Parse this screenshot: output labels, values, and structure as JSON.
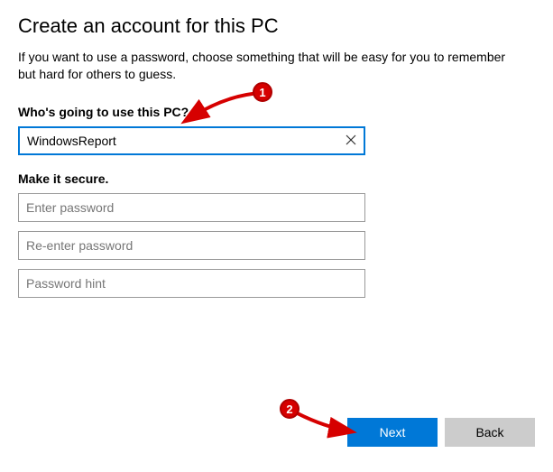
{
  "title": "Create an account for this PC",
  "description": "If you want to use a password, choose something that will be easy for you to remember but hard for others to guess.",
  "section1": {
    "label": "Who's going to use this PC?",
    "username_value": "WindowsReport"
  },
  "section2": {
    "label": "Make it secure.",
    "password_placeholder": "Enter password",
    "confirm_placeholder": "Re-enter password",
    "hint_placeholder": "Password hint"
  },
  "buttons": {
    "next": "Next",
    "back": "Back"
  },
  "annotations": {
    "badge1": "1",
    "badge2": "2"
  }
}
